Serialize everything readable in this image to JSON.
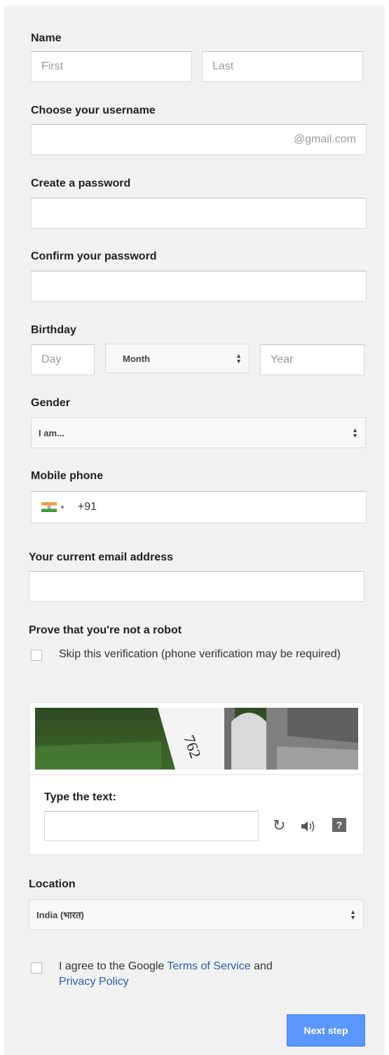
{
  "form": {
    "name": {
      "label": "Name",
      "first_placeholder": "First",
      "last_placeholder": "Last"
    },
    "username": {
      "label": "Choose your username",
      "suffix": "@gmail.com"
    },
    "password": {
      "label": "Create a password"
    },
    "confirm_password": {
      "label": "Confirm your password"
    },
    "birthday": {
      "label": "Birthday",
      "day_placeholder": "Day",
      "month_value": "Month",
      "year_placeholder": "Year"
    },
    "gender": {
      "label": "Gender",
      "value": "I am..."
    },
    "mobile": {
      "label": "Mobile phone",
      "country_code": "+91",
      "flag_icon": "india-flag-icon"
    },
    "current_email": {
      "label": "Your current email address"
    },
    "captcha": {
      "heading": "Prove that you're not a robot",
      "skip_label": "Skip this verification (phone verification may be required)",
      "image_text": "762",
      "type_label": "Type the text:",
      "icons": [
        "refresh-icon",
        "audio-icon",
        "help-icon"
      ],
      "help_glyph": "?"
    },
    "location": {
      "label": "Location",
      "value": "India (भारत)"
    },
    "terms": {
      "prefix": "I agree to the Google ",
      "tos_link": "Terms of Service",
      "middle": " and",
      "privacy_link": "Privacy Policy"
    },
    "next_button": "Next step"
  },
  "colors": {
    "panel_bg": "#f1f1f1",
    "link": "#2a5db0",
    "button_bg": "#4d90fe"
  }
}
